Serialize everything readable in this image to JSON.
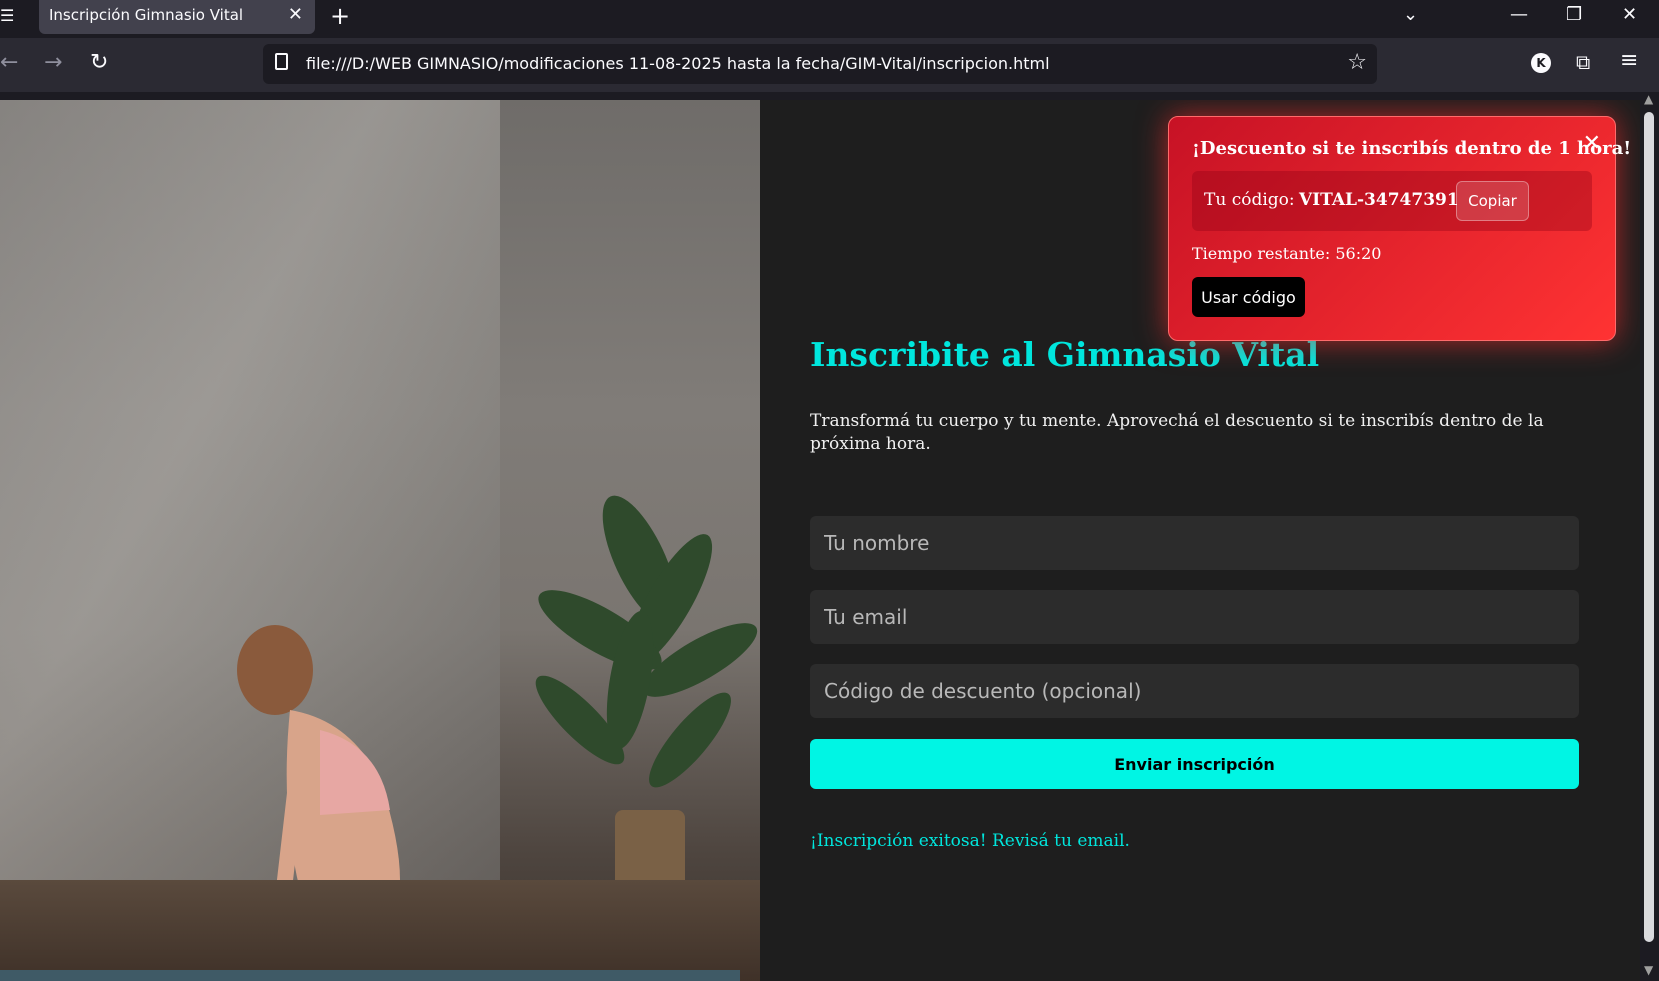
{
  "browser": {
    "tab_title": "Inscripción Gimnasio Vital",
    "url": "file:///D:/WEB GIMNASIO/modificaciones 11-08-2025 hasta la fecha/GIM-Vital/inscripcion.html",
    "account_initial": "K"
  },
  "popup": {
    "title": "¡Descuento si te inscribís dentro de 1 hora!",
    "code_label": "Tu código:",
    "code_value": "VITAL-34747391",
    "copy_label": "Copiar",
    "timer_label": "Tiempo restante: 56:20",
    "use_label": "Usar código"
  },
  "main": {
    "title": "Inscribite al Gimnasio Vital",
    "subtitle": "Transformá tu cuerpo y tu mente. Aprovechá el descuento si te inscribís dentro de la próxima hora.",
    "name_placeholder": "Tu nombre",
    "email_placeholder": "Tu email",
    "code_placeholder": "Código de descuento (opcional)",
    "submit_label": "Enviar inscripción",
    "success_message": "¡Inscripción exitosa! Revisá tu email."
  },
  "colors": {
    "accent": "#00f5e4",
    "popup_red": "#ff3333",
    "background": "#1e1e1e"
  }
}
